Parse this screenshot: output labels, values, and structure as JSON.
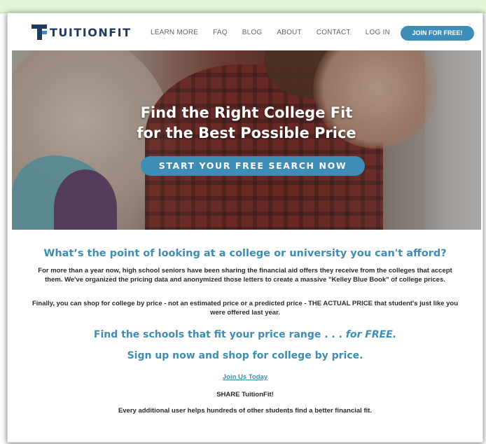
{
  "nav": {
    "brand": "TUITIONFIT",
    "links": [
      "LEARN MORE",
      "FAQ",
      "BLOG",
      "ABOUT",
      "CONTACT",
      "LOG IN"
    ],
    "join_label": "JOIN FOR FREE!"
  },
  "hero": {
    "title_line1": "Find the Right College Fit",
    "title_line2": "for the Best Possible Price",
    "cta_label": "START YOUR FREE SEARCH NOW"
  },
  "content": {
    "headline": "What’s the point of looking at a college or university you can't afford?",
    "paragraph1": "For more than a year now, high school seniors have been sharing the financial aid offers they receive from the colleges that accept them.  We've organized the pricing data and anonymized those letters to create a massive \"Kelley Blue Book\" of college prices.",
    "paragraph2": "Finally, you can shop for college by price - not an estimated price or a predicted price - THE ACTUAL PRICE that student's just like you were offered last year.",
    "sub1_main": "Find the schools that fit your price range . . . ",
    "sub1_free": "for FREE.",
    "sub2": "Sign up now and shop for college by price.",
    "join_link": "Join Us Today",
    "share": "SHARE TuitionFit!",
    "every_user": "Every additional user helps hundreds of other students find a better financial fit."
  },
  "colors": {
    "accent": "#3d8db6",
    "brand_dark": "#1f3b63",
    "text": "#2b2b2b"
  }
}
